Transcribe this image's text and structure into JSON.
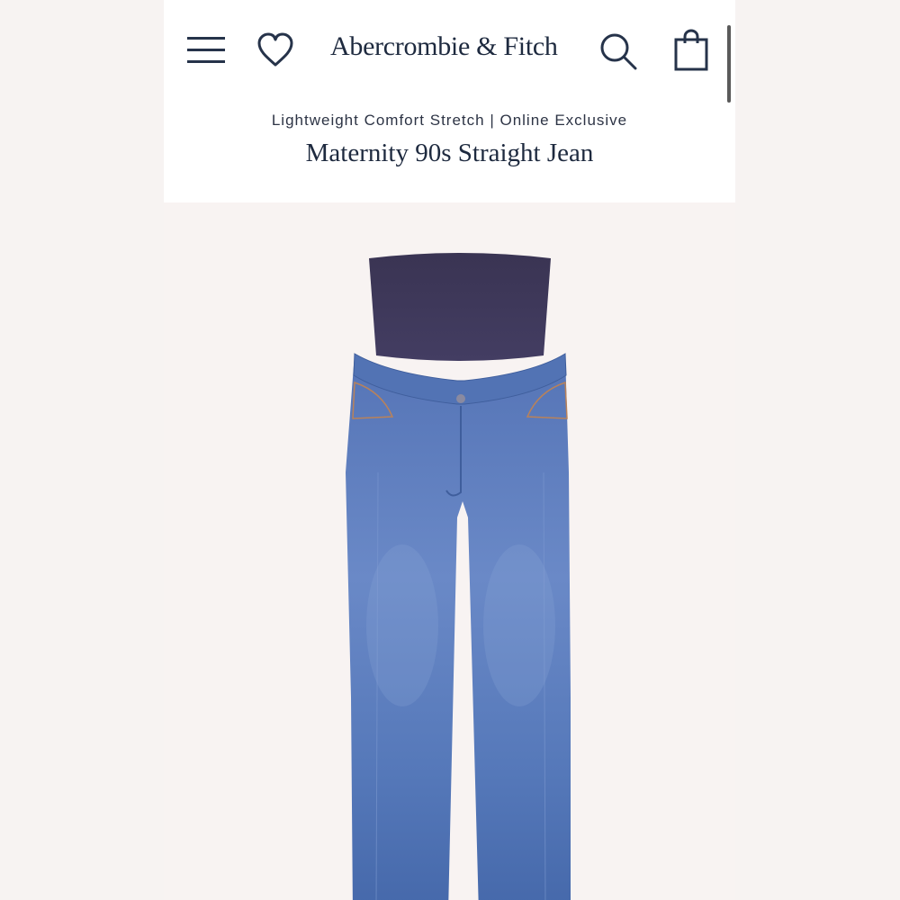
{
  "header": {
    "brand": "Abercrombie & Fitch",
    "icons": [
      "menu-icon",
      "heart-icon",
      "search-icon",
      "bag-icon"
    ]
  },
  "product": {
    "subtitle": "Lightweight Comfort Stretch | Online Exclusive",
    "title": "Maternity 90s Straight Jean",
    "image": "maternity-straight-jean-image"
  },
  "colors": {
    "brand_navy": "#1e2a3f",
    "denim": "#5d7fbd",
    "panel": "#3a3655",
    "background": "#f8f3f2"
  }
}
